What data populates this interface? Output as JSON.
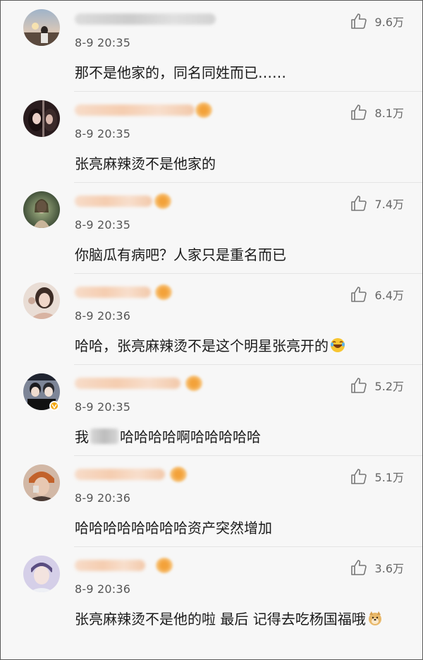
{
  "comments": [
    {
      "time": "8-9 20:35",
      "likes": "9.6万",
      "text": "那不是他家的，同名同姓而已……",
      "name_style": "gray",
      "name_width": 200,
      "vip": false,
      "verified": false
    },
    {
      "time": "8-9 20:35",
      "likes": "8.1万",
      "text": "张亮麻辣烫不是他家的",
      "name_style": "orange",
      "name_width": 170,
      "vip": true,
      "verified": false
    },
    {
      "time": "8-9 20:35",
      "likes": "7.4万",
      "text": "你脑瓜有病吧？人家只是重名而已",
      "name_style": "orange",
      "name_width": 110,
      "vip": true,
      "verified": false
    },
    {
      "time": "8-9 20:36",
      "likes": "6.4万",
      "text": "哈哈，张亮麻辣烫不是这个明星张亮开的",
      "name_style": "orange",
      "name_width": 108,
      "vip": true,
      "verified": false,
      "emoji": "laugh-cry"
    },
    {
      "time": "8-9 20:35",
      "likes": "5.2万",
      "text_before": "我",
      "text_after": "哈哈哈哈啊哈哈哈哈哈",
      "name_style": "orange",
      "name_width": 150,
      "vip": true,
      "verified": true
    },
    {
      "time": "8-9 20:36",
      "likes": "5.1万",
      "text": "哈哈哈哈哈哈哈哈资产突然增加",
      "name_style": "orange",
      "name_width": 128,
      "vip": true,
      "verified": false
    },
    {
      "time": "8-9 20:36",
      "likes": "3.6万",
      "text": "张亮麻辣烫不是他的啦 最后 记得去吃杨国福哦",
      "name_style": "orange",
      "name_width": 100,
      "vip": true,
      "verified": false,
      "emoji": "doge"
    }
  ],
  "icons": {
    "like": "thumbs-up-icon",
    "verified": "verified-badge-icon"
  },
  "colors": {
    "text": "#1a1a1a",
    "meta": "#555555",
    "like": "#666666",
    "vip": "#f3a23a",
    "verified": "#f3a712"
  }
}
